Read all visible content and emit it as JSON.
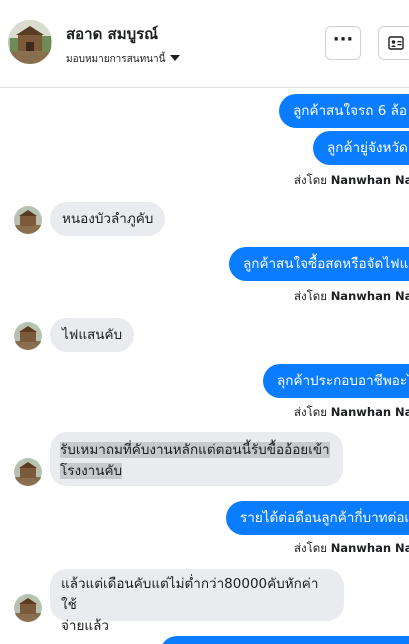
{
  "header": {
    "contact_name": "สอาด สมบูรณ์",
    "status_label": "มอบหมายการสนทนานี้",
    "more_label": "···"
  },
  "messages": {
    "out1": "ลูกค้าสนใจรถ 6 ล้อ",
    "out2": "ลูกค้ายู่จังหวัด",
    "in1": "หนองบัวลำภูคับ",
    "out3": "ลูกค้าสนใจซื้อสดหรือจัดไฟแ",
    "in2": "ไฟแสนคับ",
    "out4": "ลุกค้าประกอบอาชีพอะไ",
    "in3_line1": "รับเหมาถมที่คับงานหลักแต่ตอนนี้รับขื้ออ้อยเข้า",
    "in3_line2": "โรงงานคับ",
    "out5": "รายได้ต่อดือนลูกค้ากี่บาทต่อเ",
    "in4_line1": "แล้วแต่เดือนคับแต่ไม่ต่ำกว่า80000คับหักค่าใช้",
    "in4_line2": "จ่ายแล้ว"
  },
  "sent_by": {
    "prefix": "ส่งโดย",
    "sender": "Nanwhan Nan"
  }
}
